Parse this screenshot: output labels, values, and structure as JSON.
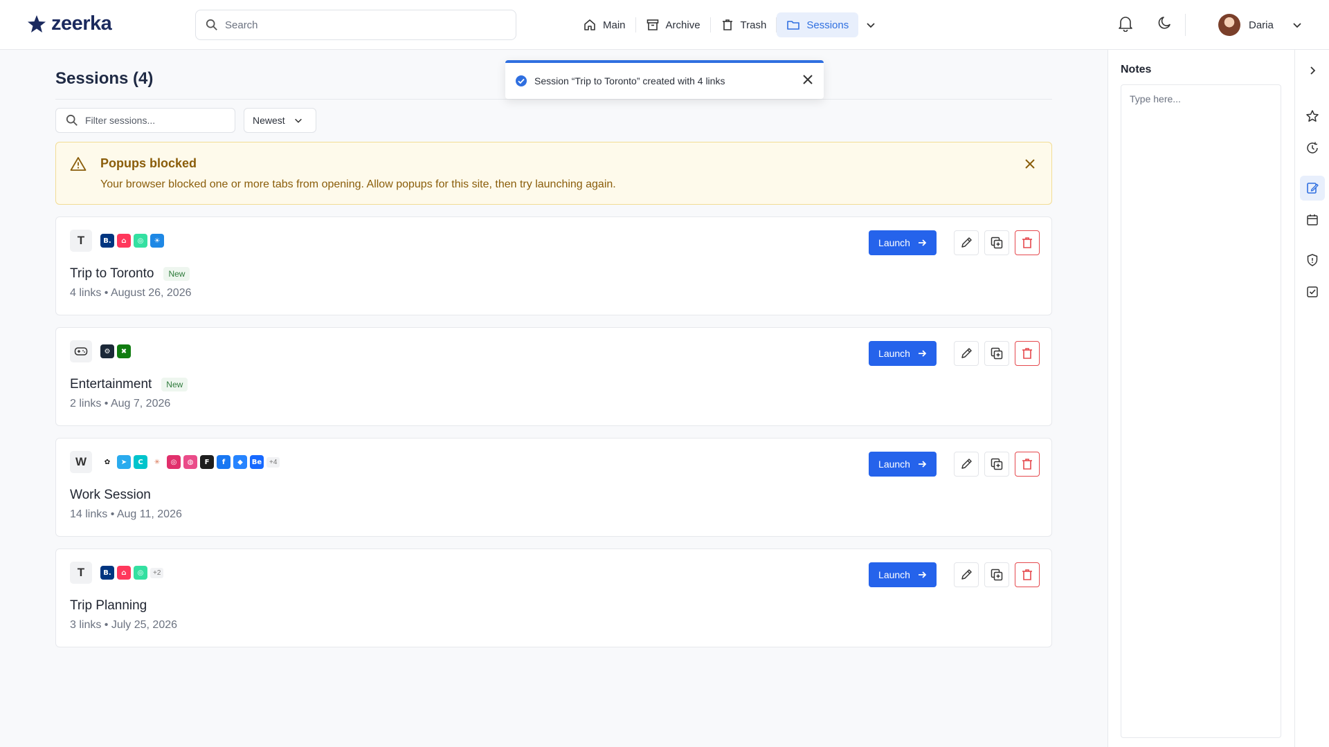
{
  "app": {
    "name": "zeerka"
  },
  "search": {
    "placeholder": "Search"
  },
  "nav": {
    "items": [
      {
        "label": "Main",
        "icon": "home-icon"
      },
      {
        "label": "Archive",
        "icon": "archive-icon"
      },
      {
        "label": "Trash",
        "icon": "trash-icon"
      },
      {
        "label": "Sessions",
        "icon": "folder-icon",
        "active": true
      }
    ]
  },
  "user": {
    "name": "Daria"
  },
  "page": {
    "title": "Sessions (4)",
    "filter_placeholder": "Filter sessions...",
    "sort_value": "Newest"
  },
  "alert": {
    "title": "Popups blocked",
    "message": "Your browser blocked one or more tabs from opening. Allow popups for this site, then try launching again."
  },
  "toast": {
    "message": "Session “Trip to Toronto” created with 4 links"
  },
  "sessions": [
    {
      "avatar": "T",
      "title": "Trip to Toronto",
      "badge": "New",
      "meta": "4 links • August 26, 2026",
      "favicons": [
        {
          "name": "booking-icon",
          "color": "#003580",
          "glyph": "B."
        },
        {
          "name": "airbnb-icon",
          "color": "#ff385c",
          "glyph": "⌂"
        },
        {
          "name": "tripadvisor-icon",
          "color": "#34e0a1",
          "glyph": "◎"
        },
        {
          "name": "weather-icon",
          "color": "#1e88e5",
          "glyph": "☀"
        }
      ],
      "more": ""
    },
    {
      "avatar": "🎮",
      "title": "Entertainment",
      "badge": "New",
      "meta": "2 links • Aug 7, 2026",
      "favicons": [
        {
          "name": "steam-icon",
          "color": "#1b2838",
          "glyph": "⚙"
        },
        {
          "name": "xbox-icon",
          "color": "#107c10",
          "glyph": "✖"
        }
      ],
      "more": ""
    },
    {
      "avatar": "W",
      "title": "Work Session",
      "badge": "",
      "meta": "14 links • Aug 11, 2026",
      "favicons": [
        {
          "name": "openai-icon",
          "color": "#ffffff",
          "glyph": "✿"
        },
        {
          "name": "telegram-icon",
          "color": "#2aabee",
          "glyph": "➤"
        },
        {
          "name": "canva-icon",
          "color": "#00c4cc",
          "glyph": "C"
        },
        {
          "name": "claude-icon",
          "color": "#ffffff",
          "glyph": "✳"
        },
        {
          "name": "instagram-icon",
          "color": "#e1306c",
          "glyph": "◎"
        },
        {
          "name": "dribbble-icon",
          "color": "#ea4c89",
          "glyph": "◍"
        },
        {
          "name": "figma-icon",
          "color": "#1e1e1e",
          "glyph": "F"
        },
        {
          "name": "facebook-icon",
          "color": "#1877f2",
          "glyph": "f"
        },
        {
          "name": "jira-icon",
          "color": "#2684ff",
          "glyph": "◆"
        },
        {
          "name": "behance-icon",
          "color": "#1769ff",
          "glyph": "Be"
        }
      ],
      "more": "+4"
    },
    {
      "avatar": "T",
      "title": "Trip Planning",
      "badge": "",
      "meta": "3 links • July 25, 2026",
      "favicons": [
        {
          "name": "booking-icon",
          "color": "#003580",
          "glyph": "B."
        },
        {
          "name": "airbnb-icon",
          "color": "#ff385c",
          "glyph": "⌂"
        },
        {
          "name": "tripadvisor-icon",
          "color": "#34e0a1",
          "glyph": "◎"
        }
      ],
      "more": "+2"
    }
  ],
  "launch_label": "Launch",
  "notes": {
    "title": "Notes",
    "placeholder": "Type here..."
  },
  "colors": {
    "accent": "#2563eb",
    "warning_text": "#8a5d0a",
    "danger": "#e5484d"
  }
}
